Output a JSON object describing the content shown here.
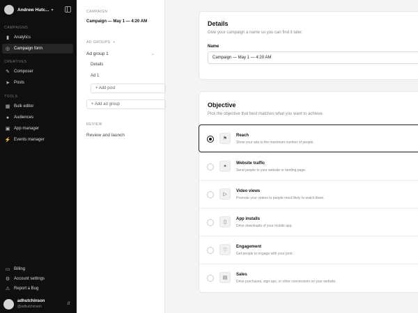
{
  "sidebar": {
    "user_name": "Andrew Hutc...",
    "sections": {
      "campaigns": "CAMPAIGNS",
      "creatives": "CREATIVES",
      "tools": "TOOLS"
    },
    "items": [
      {
        "label": "Analytics",
        "icon": "chart-icon"
      },
      {
        "label": "Campaign form",
        "icon": "target-icon",
        "active": true
      },
      {
        "label": "Composer",
        "icon": "edit-icon"
      },
      {
        "label": "Posts",
        "icon": "send-icon"
      },
      {
        "label": "Bulk editor",
        "icon": "grid-icon"
      },
      {
        "label": "Audiences",
        "icon": "people-icon"
      },
      {
        "label": "App manager",
        "icon": "app-icon"
      },
      {
        "label": "Events manager",
        "icon": "bolt-icon"
      }
    ],
    "footer_items": [
      {
        "label": "Billing",
        "icon": "card-icon"
      },
      {
        "label": "Account settings",
        "icon": "gear-icon"
      },
      {
        "label": "Report a Bug",
        "icon": "bug-icon"
      }
    ],
    "account": {
      "name": "adhutchinson",
      "handle": "@adhutchinson"
    }
  },
  "nav_panel": {
    "campaign_label": "CAMPAIGN",
    "campaign_name": "Campaign — May 1 — 4:20 AM",
    "ad_groups_label": "AD GROUPS",
    "ad_groups_plus": "+",
    "ad_group_name": "Ad group 1",
    "sub_items": [
      "Details",
      "Ad 1"
    ],
    "add_post": "+ Add post",
    "add_ad_group": "+ Add ad group",
    "review_label": "REVIEW",
    "review_item": "Review and launch"
  },
  "details": {
    "title": "Details",
    "subtitle": "Give your campaign a name so you can find it later.",
    "name_label": "Name",
    "name_value": "Campaign — May 1 — 4:20 AM"
  },
  "objective": {
    "title": "Objective",
    "subtitle": "Pick the objective that best matches what you want to achieve.",
    "selected": "Reach",
    "options": [
      {
        "title": "Reach",
        "desc": "Show your ads to the maximum number of people.",
        "icon": "megaphone-icon"
      },
      {
        "title": "Website traffic",
        "desc": "Send people to your website or landing page.",
        "icon": "cursor-icon"
      },
      {
        "title": "Video views",
        "desc": "Promote your videos to people most likely to watch them.",
        "icon": "video-icon"
      },
      {
        "title": "App installs",
        "desc": "Drive downloads of your mobile app.",
        "icon": "phone-icon"
      },
      {
        "title": "Engagement",
        "desc": "Get people to engage with your post.",
        "icon": "heart-icon"
      },
      {
        "title": "Sales",
        "desc": "Drive purchases, sign-ups, or other conversions on your website.",
        "icon": "cart-icon"
      }
    ]
  }
}
